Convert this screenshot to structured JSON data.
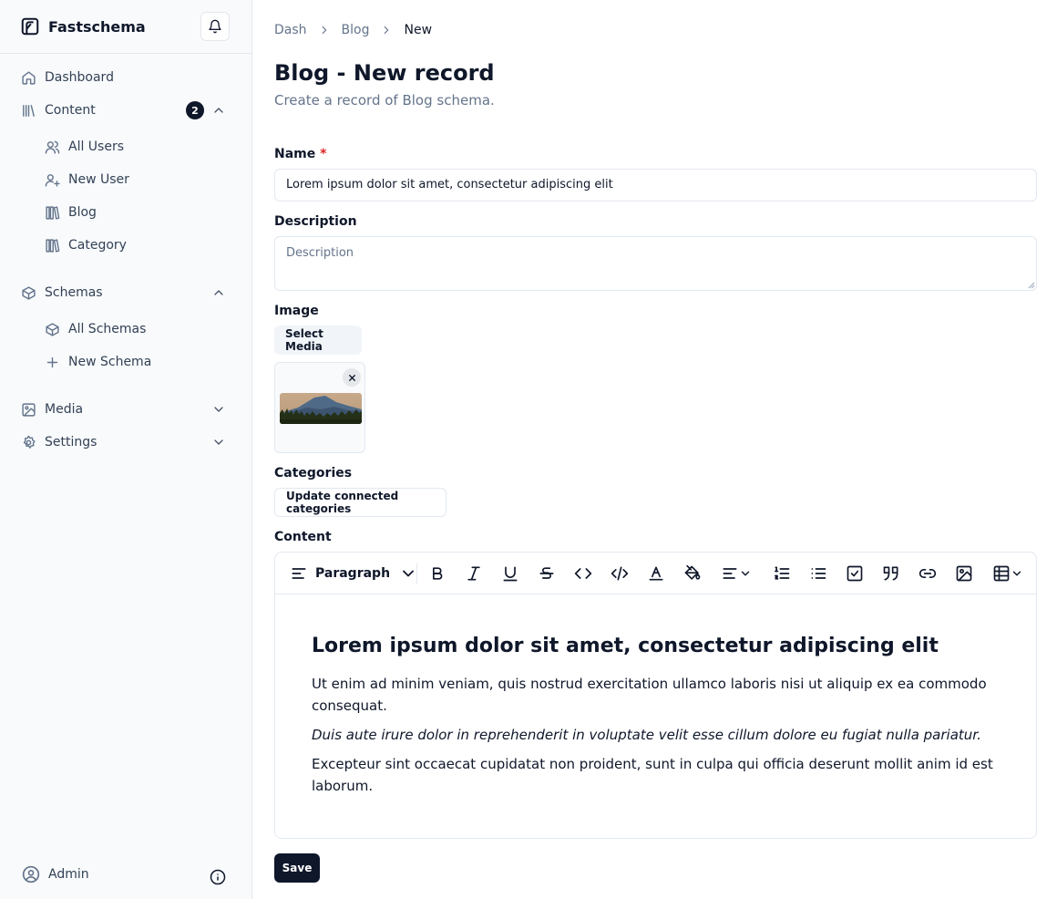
{
  "app": {
    "name": "Fastschema"
  },
  "sidebar": {
    "dashboard": "Dashboard",
    "content": {
      "label": "Content",
      "badge": "2"
    },
    "content_items": [
      "All Users",
      "New User",
      "Blog",
      "Category"
    ],
    "schemas": {
      "label": "Schemas"
    },
    "schema_items": [
      "All Schemas",
      "New Schema"
    ],
    "media": "Media",
    "settings": "Settings",
    "user": "Admin"
  },
  "breadcrumb": [
    "Dash",
    "Blog",
    "New"
  ],
  "page": {
    "title": "Blog - New record",
    "subtitle": "Create a record of Blog schema."
  },
  "form": {
    "name": {
      "label": "Name",
      "required_mark": "*",
      "value": "Lorem ipsum dolor sit amet, consectetur adipiscing elit"
    },
    "description": {
      "label": "Description",
      "placeholder": "Description"
    },
    "image": {
      "label": "Image",
      "button": "Select Media"
    },
    "categories": {
      "label": "Categories",
      "button": "Update connected categories"
    },
    "content": {
      "label": "Content",
      "block_type": "Paragraph",
      "heading": "Lorem ipsum dolor sit amet, consectetur adipiscing elit",
      "p1": "Ut enim ad minim veniam, quis nostrud exercitation ullamco laboris nisi ut aliquip ex ea commodo consequat.",
      "p2": "Duis aute irure dolor in reprehenderit in voluptate velit esse cillum dolore eu fugiat nulla pariatur.",
      "p3": "Excepteur sint occaecat cupidatat non proident, sunt in culpa qui officia deserunt mollit anim id est laborum."
    },
    "save": "Save"
  }
}
